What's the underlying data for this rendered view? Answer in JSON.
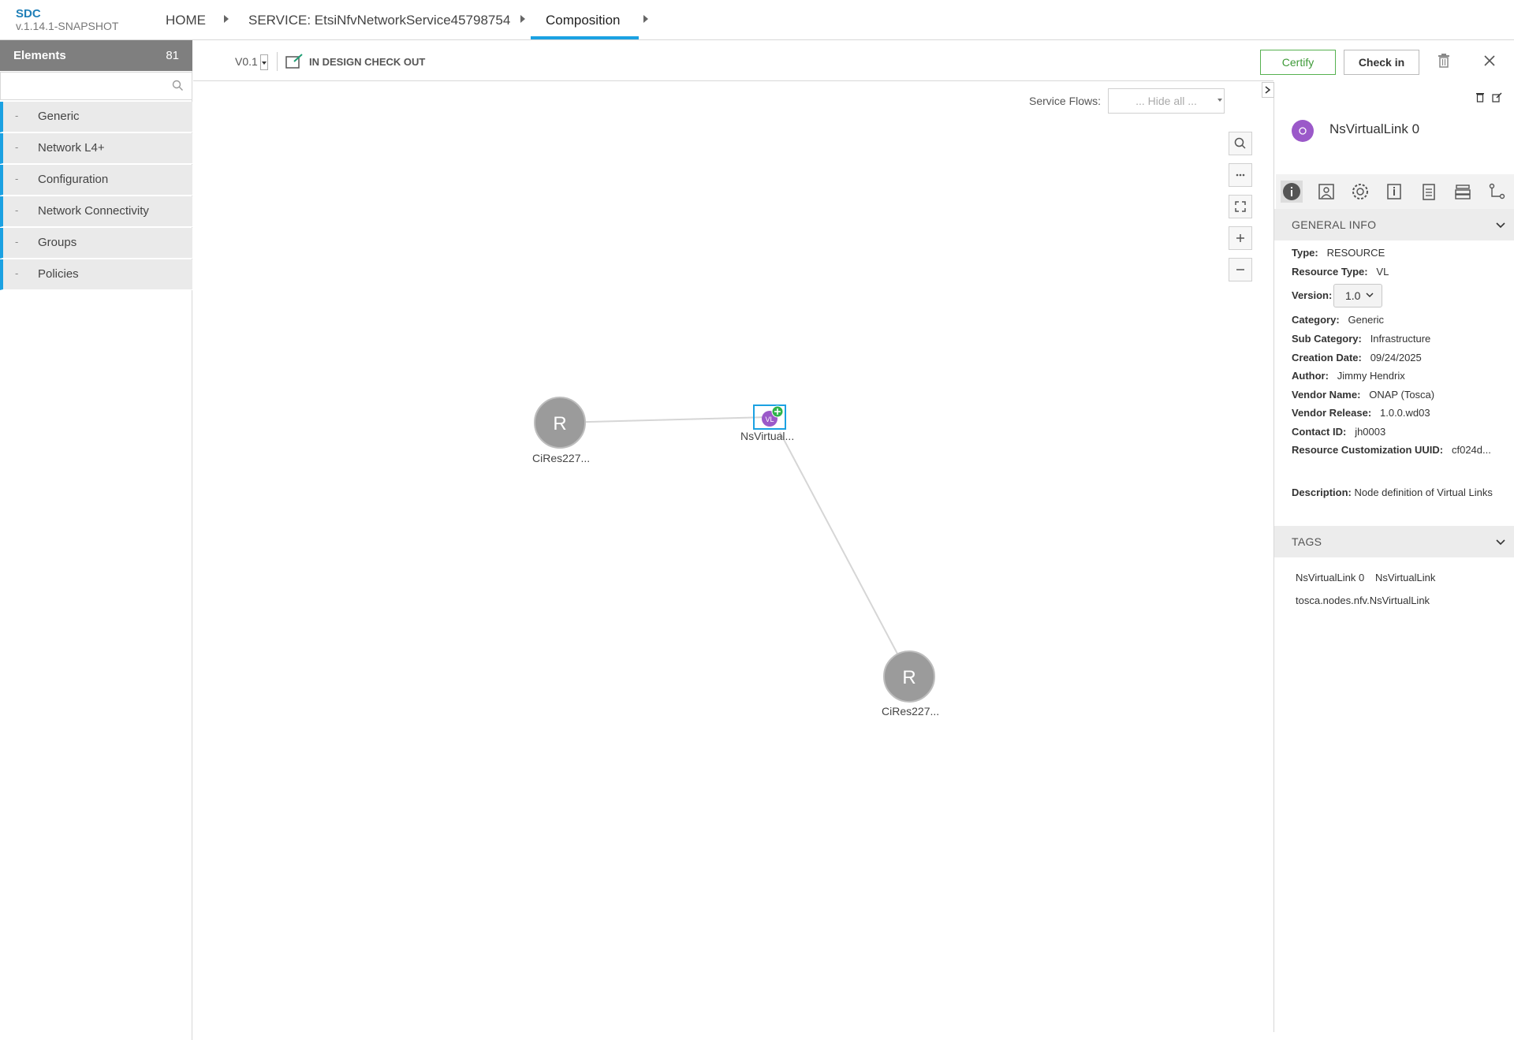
{
  "app": {
    "name": "SDC",
    "version": "v.1.14.1-SNAPSHOT"
  },
  "breadcrumb": {
    "home": "HOME",
    "service": "SERVICE: EtsiNfvNetworkService45798754",
    "current": "Composition"
  },
  "palette": {
    "title": "Elements",
    "count": "81",
    "search_placeholder": "",
    "items": [
      {
        "dash": "-",
        "label": "Generic"
      },
      {
        "dash": "-",
        "label": "Network L4+"
      },
      {
        "dash": "-",
        "label": "Configuration"
      },
      {
        "dash": "-",
        "label": "Network Connectivity"
      },
      {
        "dash": "-",
        "label": "Groups"
      },
      {
        "dash": "-",
        "label": "Policies"
      }
    ]
  },
  "toolbar": {
    "version": "V0.1",
    "status": "IN DESIGN CHECK OUT",
    "certify": "Certify",
    "checkin": "Check in"
  },
  "canvas": {
    "service_flows_label": "Service Flows:",
    "service_flows_value": "... Hide all ...",
    "nodes": [
      {
        "letter": "R",
        "label": "CiRes227..."
      },
      {
        "letter": "VL",
        "label": "NsVirtual..."
      },
      {
        "letter": "R",
        "label": "CiRes227..."
      }
    ]
  },
  "panel": {
    "title": "NsVirtualLink 0",
    "general_info_title": "GENERAL INFO",
    "info": [
      {
        "key": "Type:",
        "value": "RESOURCE"
      },
      {
        "key": "Resource Type:",
        "value": "VL"
      },
      {
        "key": "Version:",
        "value": "1.0"
      },
      {
        "key": "Category:",
        "value": "Generic"
      },
      {
        "key": "Sub Category:",
        "value": "Infrastructure"
      },
      {
        "key": "Creation Date:",
        "value": "09/24/2025"
      },
      {
        "key": "Author:",
        "value": "Jimmy Hendrix"
      },
      {
        "key": "Vendor Name:",
        "value": "ONAP (Tosca)"
      },
      {
        "key": "Vendor Release:",
        "value": "1.0.0.wd03"
      },
      {
        "key": "Contact ID:",
        "value": "jh0003"
      },
      {
        "key": "Resource Customization UUID:",
        "value": "cf024d..."
      }
    ],
    "description_key": "Description:",
    "description_value": "Node definition of Virtual Links",
    "tags_title": "TAGS",
    "tags": [
      "NsVirtualLink 0",
      "NsVirtualLink",
      "tosca.nodes.nfv.NsVirtualLink"
    ]
  },
  "colors": {
    "accent": "#1ba1e2",
    "certify": "#56b150",
    "node_gray": "#9b9b9b",
    "vl_purple": "#9b59c9"
  }
}
